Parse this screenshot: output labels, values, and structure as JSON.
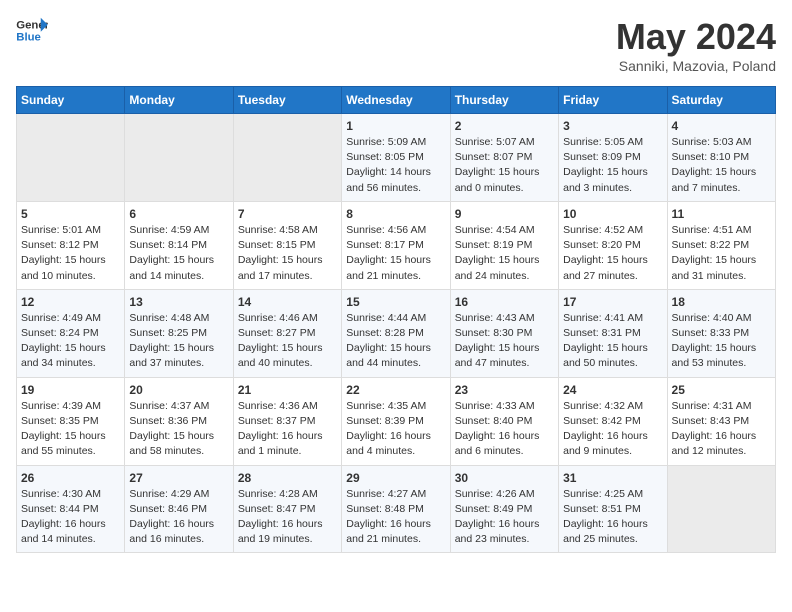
{
  "header": {
    "logo_general": "General",
    "logo_blue": "Blue",
    "title": "May 2024",
    "subtitle": "Sanniki, Mazovia, Poland"
  },
  "days_of_week": [
    "Sunday",
    "Monday",
    "Tuesday",
    "Wednesday",
    "Thursday",
    "Friday",
    "Saturday"
  ],
  "weeks": [
    [
      {
        "day": "",
        "content": ""
      },
      {
        "day": "",
        "content": ""
      },
      {
        "day": "",
        "content": ""
      },
      {
        "day": "1",
        "content": "Sunrise: 5:09 AM\nSunset: 8:05 PM\nDaylight: 14 hours\nand 56 minutes."
      },
      {
        "day": "2",
        "content": "Sunrise: 5:07 AM\nSunset: 8:07 PM\nDaylight: 15 hours\nand 0 minutes."
      },
      {
        "day": "3",
        "content": "Sunrise: 5:05 AM\nSunset: 8:09 PM\nDaylight: 15 hours\nand 3 minutes."
      },
      {
        "day": "4",
        "content": "Sunrise: 5:03 AM\nSunset: 8:10 PM\nDaylight: 15 hours\nand 7 minutes."
      }
    ],
    [
      {
        "day": "5",
        "content": "Sunrise: 5:01 AM\nSunset: 8:12 PM\nDaylight: 15 hours\nand 10 minutes."
      },
      {
        "day": "6",
        "content": "Sunrise: 4:59 AM\nSunset: 8:14 PM\nDaylight: 15 hours\nand 14 minutes."
      },
      {
        "day": "7",
        "content": "Sunrise: 4:58 AM\nSunset: 8:15 PM\nDaylight: 15 hours\nand 17 minutes."
      },
      {
        "day": "8",
        "content": "Sunrise: 4:56 AM\nSunset: 8:17 PM\nDaylight: 15 hours\nand 21 minutes."
      },
      {
        "day": "9",
        "content": "Sunrise: 4:54 AM\nSunset: 8:19 PM\nDaylight: 15 hours\nand 24 minutes."
      },
      {
        "day": "10",
        "content": "Sunrise: 4:52 AM\nSunset: 8:20 PM\nDaylight: 15 hours\nand 27 minutes."
      },
      {
        "day": "11",
        "content": "Sunrise: 4:51 AM\nSunset: 8:22 PM\nDaylight: 15 hours\nand 31 minutes."
      }
    ],
    [
      {
        "day": "12",
        "content": "Sunrise: 4:49 AM\nSunset: 8:24 PM\nDaylight: 15 hours\nand 34 minutes."
      },
      {
        "day": "13",
        "content": "Sunrise: 4:48 AM\nSunset: 8:25 PM\nDaylight: 15 hours\nand 37 minutes."
      },
      {
        "day": "14",
        "content": "Sunrise: 4:46 AM\nSunset: 8:27 PM\nDaylight: 15 hours\nand 40 minutes."
      },
      {
        "day": "15",
        "content": "Sunrise: 4:44 AM\nSunset: 8:28 PM\nDaylight: 15 hours\nand 44 minutes."
      },
      {
        "day": "16",
        "content": "Sunrise: 4:43 AM\nSunset: 8:30 PM\nDaylight: 15 hours\nand 47 minutes."
      },
      {
        "day": "17",
        "content": "Sunrise: 4:41 AM\nSunset: 8:31 PM\nDaylight: 15 hours\nand 50 minutes."
      },
      {
        "day": "18",
        "content": "Sunrise: 4:40 AM\nSunset: 8:33 PM\nDaylight: 15 hours\nand 53 minutes."
      }
    ],
    [
      {
        "day": "19",
        "content": "Sunrise: 4:39 AM\nSunset: 8:35 PM\nDaylight: 15 hours\nand 55 minutes."
      },
      {
        "day": "20",
        "content": "Sunrise: 4:37 AM\nSunset: 8:36 PM\nDaylight: 15 hours\nand 58 minutes."
      },
      {
        "day": "21",
        "content": "Sunrise: 4:36 AM\nSunset: 8:37 PM\nDaylight: 16 hours\nand 1 minute."
      },
      {
        "day": "22",
        "content": "Sunrise: 4:35 AM\nSunset: 8:39 PM\nDaylight: 16 hours\nand 4 minutes."
      },
      {
        "day": "23",
        "content": "Sunrise: 4:33 AM\nSunset: 8:40 PM\nDaylight: 16 hours\nand 6 minutes."
      },
      {
        "day": "24",
        "content": "Sunrise: 4:32 AM\nSunset: 8:42 PM\nDaylight: 16 hours\nand 9 minutes."
      },
      {
        "day": "25",
        "content": "Sunrise: 4:31 AM\nSunset: 8:43 PM\nDaylight: 16 hours\nand 12 minutes."
      }
    ],
    [
      {
        "day": "26",
        "content": "Sunrise: 4:30 AM\nSunset: 8:44 PM\nDaylight: 16 hours\nand 14 minutes."
      },
      {
        "day": "27",
        "content": "Sunrise: 4:29 AM\nSunset: 8:46 PM\nDaylight: 16 hours\nand 16 minutes."
      },
      {
        "day": "28",
        "content": "Sunrise: 4:28 AM\nSunset: 8:47 PM\nDaylight: 16 hours\nand 19 minutes."
      },
      {
        "day": "29",
        "content": "Sunrise: 4:27 AM\nSunset: 8:48 PM\nDaylight: 16 hours\nand 21 minutes."
      },
      {
        "day": "30",
        "content": "Sunrise: 4:26 AM\nSunset: 8:49 PM\nDaylight: 16 hours\nand 23 minutes."
      },
      {
        "day": "31",
        "content": "Sunrise: 4:25 AM\nSunset: 8:51 PM\nDaylight: 16 hours\nand 25 minutes."
      },
      {
        "day": "",
        "content": ""
      }
    ]
  ]
}
